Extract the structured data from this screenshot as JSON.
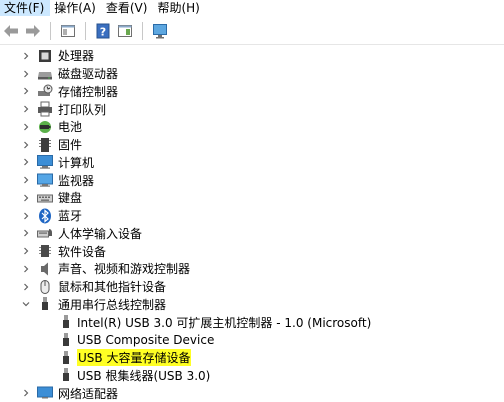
{
  "menu": {
    "items": [
      {
        "label": "文件(F)"
      },
      {
        "label": "操作(A)"
      },
      {
        "label": "查看(V)"
      },
      {
        "label": "帮助(H)"
      }
    ]
  },
  "toolbar": {
    "back_icon": "arrow-left-icon",
    "forward_icon": "arrow-right-icon",
    "properties_icon": "properties-icon",
    "help_icon": "help-icon",
    "update_icon": "update-driver-icon",
    "scan_icon": "monitor-scan-icon"
  },
  "tree": {
    "categories": [
      {
        "label": "处理器",
        "icon": "processor-icon",
        "expanded": false
      },
      {
        "label": "磁盘驱动器",
        "icon": "disk-drive-icon",
        "expanded": false
      },
      {
        "label": "存储控制器",
        "icon": "storage-controller-icon",
        "expanded": false
      },
      {
        "label": "打印队列",
        "icon": "printer-icon",
        "expanded": false
      },
      {
        "label": "电池",
        "icon": "battery-icon",
        "expanded": false
      },
      {
        "label": "固件",
        "icon": "firmware-icon",
        "expanded": false
      },
      {
        "label": "计算机",
        "icon": "computer-icon",
        "expanded": false
      },
      {
        "label": "监视器",
        "icon": "monitor-icon",
        "expanded": false
      },
      {
        "label": "键盘",
        "icon": "keyboard-icon",
        "expanded": false
      },
      {
        "label": "蓝牙",
        "icon": "bluetooth-icon",
        "expanded": false
      },
      {
        "label": "人体学输入设备",
        "icon": "hid-icon",
        "expanded": false
      },
      {
        "label": "软件设备",
        "icon": "software-device-icon",
        "expanded": false
      },
      {
        "label": "声音、视频和游戏控制器",
        "icon": "sound-icon",
        "expanded": false
      },
      {
        "label": "鼠标和其他指针设备",
        "icon": "mouse-icon",
        "expanded": false
      },
      {
        "label": "通用串行总线控制器",
        "icon": "usb-icon",
        "expanded": true
      },
      {
        "label": "网络适配器",
        "icon": "network-icon",
        "expanded": false
      }
    ],
    "usb_children": [
      {
        "label": "Intel(R) USB 3.0 可扩展主机控制器 - 1.0 (Microsoft)",
        "icon": "usb-device-icon",
        "highlighted": false
      },
      {
        "label": "USB Composite Device",
        "icon": "usb-device-icon",
        "highlighted": false
      },
      {
        "label": "USB 大容量存储设备",
        "icon": "usb-device-icon",
        "highlighted": true
      },
      {
        "label": "USB 根集线器(USB 3.0)",
        "icon": "usb-device-icon",
        "highlighted": false
      }
    ]
  },
  "colors": {
    "highlight": "#ffff24",
    "selection_hover": "#cce8ff"
  }
}
